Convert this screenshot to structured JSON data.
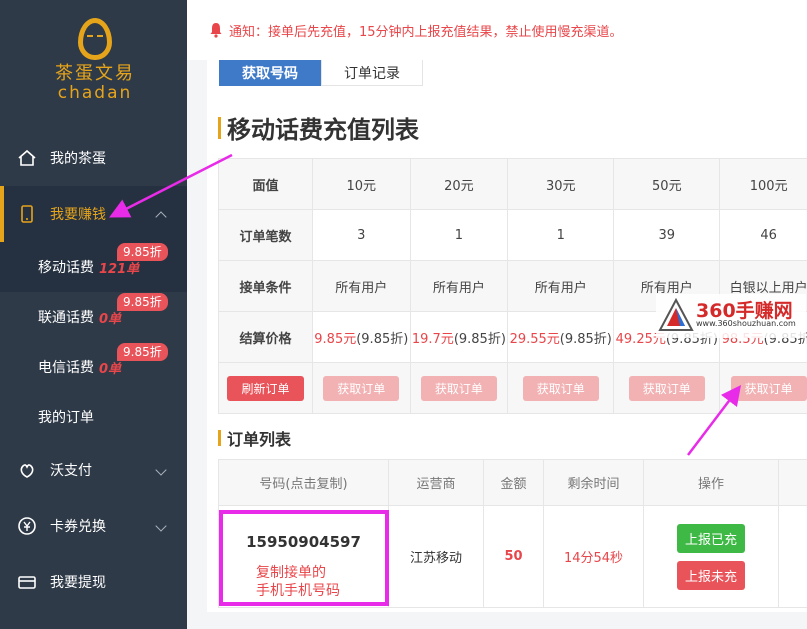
{
  "sidebar": {
    "logo_cn": "茶蛋文易",
    "logo_en": "chadan",
    "items": [
      {
        "label": "我的茶蛋"
      },
      {
        "label": "我要赚钱"
      },
      {
        "label": "沃支付"
      },
      {
        "label": "卡券兑换"
      },
      {
        "label": "我要提现"
      }
    ],
    "subitems": [
      {
        "label": "移动话费",
        "count": "121单",
        "badge": "9.85折"
      },
      {
        "label": "联通话费",
        "count": "0单",
        "badge": "9.85折"
      },
      {
        "label": "电信话费",
        "count": "0单",
        "badge": "9.85折"
      },
      {
        "label": "我的订单"
      }
    ]
  },
  "notice": {
    "text": "通知：接单后先充值，15分钟内上报充值结果，禁止使用慢充渠道。"
  },
  "tabs": [
    {
      "label": "获取号码"
    },
    {
      "label": "订单记录"
    }
  ],
  "price_section": {
    "title": "移动话费充值列表",
    "rows": {
      "face_label": "面值",
      "faces": [
        "10元",
        "20元",
        "30元",
        "50元",
        "100元"
      ],
      "orders_label": "订单笔数",
      "orders": [
        "3",
        "1",
        "1",
        "39",
        "46"
      ],
      "cond_label": "接单条件",
      "conds": [
        "所有用户",
        "所有用户",
        "所有用户",
        "所有用户",
        "白银以上用户"
      ],
      "settle_label": "结算价格",
      "prices": [
        "9.85元",
        "19.7元",
        "29.55元",
        "49.25元",
        "98.5元"
      ],
      "discount": "(9.85折)",
      "refresh_btn": "刷新订单",
      "get_btn": "获取订单"
    }
  },
  "order_section": {
    "title": "订单列表",
    "headers": [
      "号码(点击复制)",
      "运营商",
      "金额",
      "剩余时间",
      "操作"
    ],
    "row": {
      "phone": "15950904597",
      "operator": "江苏移动",
      "amount": "50",
      "remaining": "14分54秒",
      "btn_done": "上报已充",
      "btn_undone": "上报未充"
    }
  },
  "annotation": {
    "line1": "复制接单的",
    "line2": "手机手机号码"
  },
  "watermark": {
    "main": "360手赚网",
    "sub": "www.360shouzhuan.com"
  },
  "colors": {
    "sidebar_bg": "#2f3a48",
    "accent": "#e6a41b",
    "primary": "#3f7ac9",
    "danger": "#e8545a",
    "success": "#3eb946",
    "annotation": "#e82be8"
  }
}
